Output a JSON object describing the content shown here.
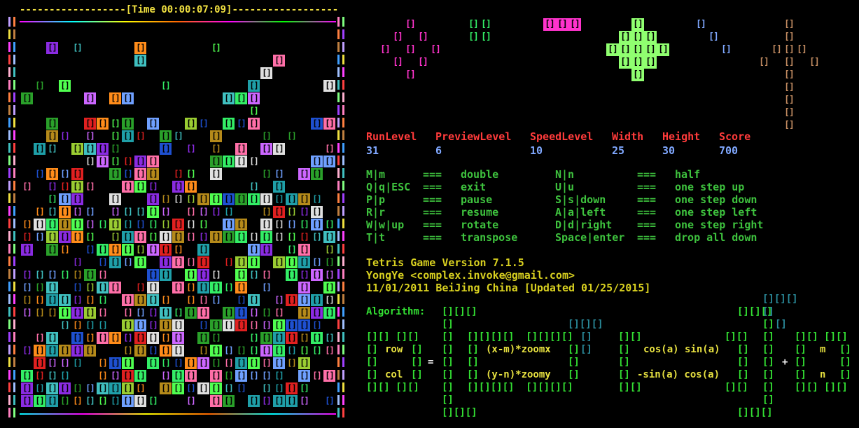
{
  "header": {
    "time_label": "Time",
    "time_value": "00:00:07:09"
  },
  "stats": [
    {
      "label": "RunLevel",
      "value": "31"
    },
    {
      "label": "PreviewLevel",
      "value": "6"
    },
    {
      "label": "SpeedLevel",
      "value": "10"
    },
    {
      "label": "Width",
      "value": "25"
    },
    {
      "label": "Height",
      "value": "30"
    },
    {
      "label": "Score",
      "value": "700"
    }
  ],
  "keys": [
    {
      "key": "M|m",
      "action": "double",
      "key2": "N|n",
      "action2": "half"
    },
    {
      "key": "Q|q|ESC",
      "action": "exit",
      "key2": "U|u",
      "action2": "one step up"
    },
    {
      "key": "P|p",
      "action": "pause",
      "key2": "S|s|down",
      "action2": "one step down"
    },
    {
      "key": "R|r",
      "action": "resume",
      "key2": "A|a|left",
      "action2": "one step left"
    },
    {
      "key": "W|w|up",
      "action": "rotate",
      "key2": "D|d|right",
      "action2": "one step right"
    },
    {
      "key": "T|t",
      "action": "transpose",
      "key2": "Space|enter",
      "action2": "drop all down"
    }
  ],
  "separator": "===",
  "info": {
    "line1": "Tetris Game  Version 7.1.5",
    "line2": "YongYe <complex.invoke@gmail.com>",
    "line3": "11/01/2011 BeiJing China [Updated 01/25/2015]"
  },
  "algorithm": {
    "label": "Algorithm:",
    "row": "row",
    "col": "col",
    "x_expr": "(x-m)*zoomx",
    "y_expr": "(y-n)*zoomy",
    "cos_a": "cos(a)",
    "sin_a": "sin(a)",
    "neg_sin_a": "-sin(a)",
    "m": "m",
    "n": "n",
    "eq": "=",
    "plus": "+"
  },
  "colors": {
    "time": "#f0e040",
    "label_red": "#ff3b3b",
    "value_blue": "#80a8ff",
    "key_green": "#3ec23e",
    "info_yellow": "#d8d020",
    "algo_green": "#33e033",
    "algo_teal": "#2a8a9a"
  }
}
